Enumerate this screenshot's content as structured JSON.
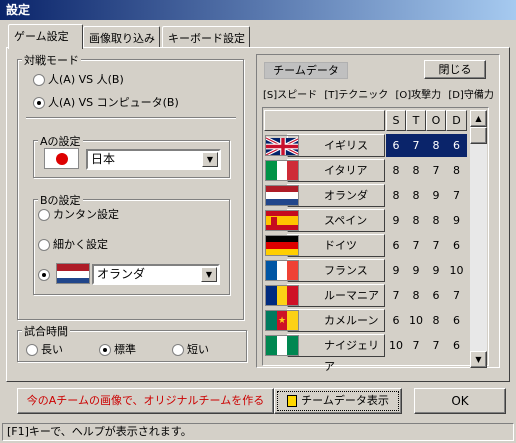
{
  "window": {
    "title": "設定"
  },
  "tabs": [
    {
      "label": "ゲーム設定",
      "active": true
    },
    {
      "label": "画像取り込み",
      "active": false
    },
    {
      "label": "キーボード設定",
      "active": false
    }
  ],
  "battle_mode": {
    "label": "対戦モード",
    "options": [
      {
        "label": "人(A) VS 人(B)",
        "selected": false
      },
      {
        "label": "人(A) VS コンピュータ(B)",
        "selected": true
      }
    ]
  },
  "a_settings": {
    "label": "Aの設定",
    "team": "日本"
  },
  "b_settings": {
    "label": "Bの設定",
    "options": [
      {
        "label": "カンタン設定",
        "selected": false
      },
      {
        "label": "細かく設定",
        "selected": false
      }
    ],
    "team": "オランダ",
    "team_selected": true
  },
  "match_time": {
    "label": "試合時間",
    "options": [
      {
        "label": "長い",
        "selected": false
      },
      {
        "label": "標準",
        "selected": true
      },
      {
        "label": "短い",
        "selected": false
      }
    ]
  },
  "team_data": {
    "title": "チームデータ",
    "close_label": "閉じる",
    "legend": [
      "[S]スピード",
      "[T]テクニック",
      "[O]攻撃力",
      "[D]守備力"
    ],
    "columns": [
      "S",
      "T",
      "O",
      "D"
    ],
    "teams": [
      {
        "name": "イギリス",
        "flag": "uk",
        "S": "6",
        "T": "7",
        "O": "8",
        "D": "6",
        "highlight": true
      },
      {
        "name": "イタリア",
        "flag": "italy",
        "S": "8",
        "T": "8",
        "O": "7",
        "D": "8"
      },
      {
        "name": "オランダ",
        "flag": "netherlands",
        "S": "8",
        "T": "8",
        "O": "9",
        "D": "7"
      },
      {
        "name": "スペイン",
        "flag": "spain",
        "S": "9",
        "T": "8",
        "O": "8",
        "D": "9"
      },
      {
        "name": "ドイツ",
        "flag": "germany",
        "S": "6",
        "T": "7",
        "O": "7",
        "D": "6"
      },
      {
        "name": "フランス",
        "flag": "france",
        "S": "9",
        "T": "9",
        "O": "9",
        "D": "10"
      },
      {
        "name": "ルーマニア",
        "flag": "romania",
        "S": "7",
        "T": "8",
        "O": "6",
        "D": "7"
      },
      {
        "name": "カメルーン",
        "flag": "cameroon",
        "S": "6",
        "T": "10",
        "O": "8",
        "D": "6"
      },
      {
        "name": "ナイジェリア",
        "flag": "nigeria",
        "S": "10",
        "T": "7",
        "O": "7",
        "D": "6"
      }
    ]
  },
  "buttons": {
    "original_team": "今のAチームの画像で、オリジナルチームを作る",
    "show_team_data": "チームデータ表示",
    "ok": "OK"
  },
  "status": "[F1]キーで、ヘルプが表示されます。",
  "colors": {
    "title_start": "#0a246a",
    "title_end": "#a6caf0",
    "highlight": "#0a246a",
    "original_button_text": "#cc0000"
  }
}
